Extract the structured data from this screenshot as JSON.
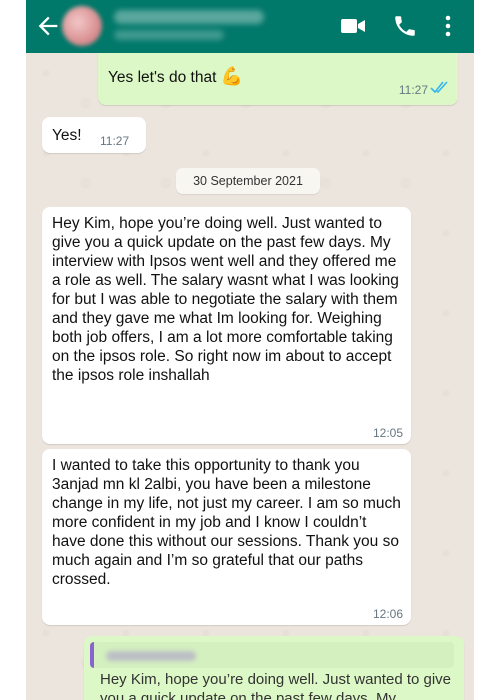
{
  "header": {
    "contact_name": "",
    "contact_status": "",
    "colors": {
      "bar": "#00786a",
      "icons": "#ffffff"
    },
    "icons": [
      "back-arrow-icon",
      "video-call-icon",
      "phone-call-icon",
      "more-options-icon"
    ]
  },
  "chat": {
    "messages": [
      {
        "direction": "outgoing",
        "text": "Yes let's do that",
        "emoji": "💪",
        "time": "11:27",
        "status": "read"
      },
      {
        "direction": "incoming",
        "text": "Yes!",
        "time": "11:27"
      },
      {
        "type": "date",
        "text": "30 September 2021"
      },
      {
        "direction": "incoming",
        "text": "Hey Kim, hope you’re doing well. Just wanted to give you a quick update on the past few days. My interview with Ipsos went well and they offered me a role as well. The salary wasnt what I was looking for but I was able to negotiate the salary with them and they gave me what Im looking for. Weighing both job offers, I am a lot more comfortable taking on the ipsos role. So right now im about to accept the ipsos role inshallah",
        "time": "12:05"
      },
      {
        "direction": "incoming",
        "text": "I wanted to take this opportunity to thank you 3anjad mn kl 2albi, you have been a milestone change in my life, not just my career. I am so much more confident in my job and I know I couldn’t have done this without our sessions. Thank you so much again and I’m so grateful that our paths crossed.",
        "time": "12:06"
      },
      {
        "direction": "outgoing",
        "quoted_author": "",
        "quoted_text": "Hey Kim, hope you’re doing well. Just wanted to give you a quick update on the past few days. My"
      }
    ]
  },
  "colors": {
    "chat_background": "#ece5dd",
    "outgoing_bubble": "#dcf8c6",
    "incoming_bubble": "#ffffff",
    "read_ticks": "#34b7f1",
    "quote_bar": "#8a63d2"
  }
}
